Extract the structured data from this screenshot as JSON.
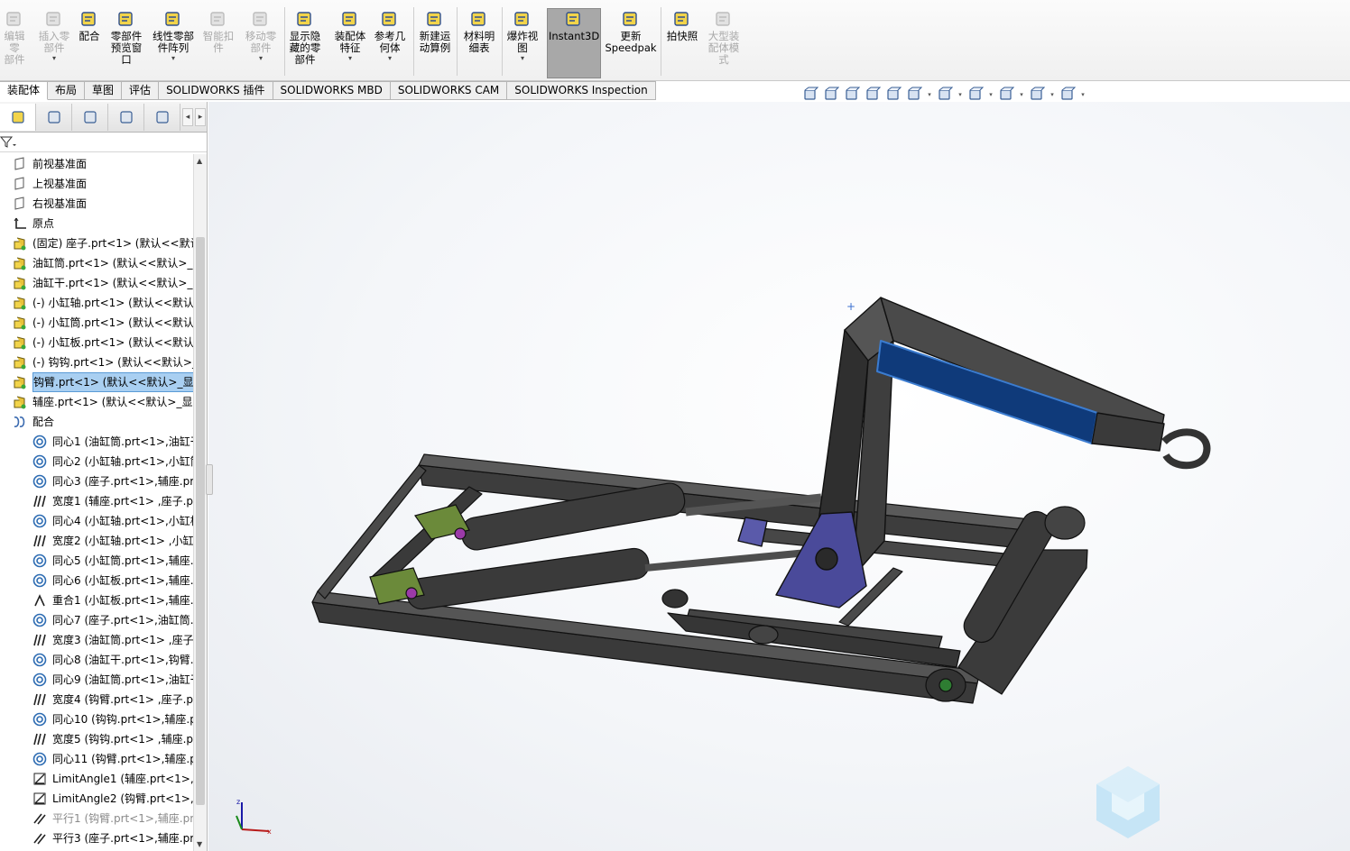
{
  "ribbon": {
    "buttons": [
      {
        "label": "编辑零\n部件",
        "icon": "edit-component-icon",
        "enabled": false
      },
      {
        "label": "插入零\n部件",
        "icon": "insert-component-icon",
        "enabled": false,
        "dropdown": true
      },
      {
        "label": "配合",
        "icon": "mate-icon",
        "enabled": true
      },
      {
        "label": "零部件\n预览窗\n口",
        "icon": "component-preview-icon",
        "enabled": true
      },
      {
        "label": "线性零部\n件阵列",
        "icon": "linear-pattern-icon",
        "enabled": true,
        "dropdown": true
      },
      {
        "label": "智能扣\n件",
        "icon": "smart-fasteners-icon",
        "enabled": false
      },
      {
        "label": "移动零\n部件",
        "icon": "move-component-icon",
        "enabled": false,
        "dropdown": true
      },
      {
        "label": "显示隐\n藏的零\n部件",
        "icon": "show-hidden-icon",
        "enabled": true
      },
      {
        "label": "装配体\n特征",
        "icon": "assembly-feature-icon",
        "enabled": true,
        "dropdown": true
      },
      {
        "label": "参考几\n何体",
        "icon": "reference-geometry-icon",
        "enabled": true,
        "dropdown": true
      },
      {
        "label": "新建运\n动算例",
        "icon": "motion-study-icon",
        "enabled": true
      },
      {
        "label": "材料明\n细表",
        "icon": "bom-icon",
        "enabled": true
      },
      {
        "label": "爆炸视\n图",
        "icon": "exploded-view-icon",
        "enabled": true,
        "dropdown": true
      },
      {
        "label": "Instant3D",
        "icon": "instant3d-icon",
        "enabled": true,
        "active": true
      },
      {
        "label": "更新\nSpeedpak",
        "icon": "speedpak-icon",
        "enabled": true
      },
      {
        "label": "拍快照",
        "icon": "snapshot-icon",
        "enabled": true
      },
      {
        "label": "大型装\n配体模\n式",
        "icon": "large-assembly-icon",
        "enabled": false
      }
    ]
  },
  "tabs": [
    "装配体",
    "布局",
    "草图",
    "评估",
    "SOLIDWORKS 插件",
    "SOLIDWORKS MBD",
    "SOLIDWORKS CAM",
    "SOLIDWORKS Inspection"
  ],
  "active_tab": "装配体",
  "panel": {
    "tabs": [
      "featuremanager-icon",
      "propertymanager-icon",
      "configurationmanager-icon",
      "dimxpert-icon",
      "display-manager-icon"
    ],
    "tree": [
      {
        "label": "前视基准面",
        "icon": "plane-icon",
        "indent": 0
      },
      {
        "label": "上视基准面",
        "icon": "plane-icon",
        "indent": 0
      },
      {
        "label": "右视基准面",
        "icon": "plane-icon",
        "indent": 0
      },
      {
        "label": "原点",
        "icon": "origin-icon",
        "indent": 0
      },
      {
        "label": "(固定) 座子.prt<1> (默认<<默认",
        "icon": "part-icon",
        "indent": 0
      },
      {
        "label": "油缸筒.prt<1> (默认<<默认>_显",
        "icon": "part-icon",
        "indent": 0
      },
      {
        "label": "油缸干.prt<1> (默认<<默认>_显",
        "icon": "part-icon",
        "indent": 0
      },
      {
        "label": "(-) 小缸轴.prt<1> (默认<<默认",
        "icon": "part-icon",
        "indent": 0
      },
      {
        "label": "(-) 小缸筒.prt<1> (默认<<默认",
        "icon": "part-icon",
        "indent": 0
      },
      {
        "label": "(-) 小缸板.prt<1> (默认<<默认",
        "icon": "part-icon",
        "indent": 0
      },
      {
        "label": "(-) 钩钩.prt<1> (默认<<默认>_",
        "icon": "part-icon",
        "indent": 0
      },
      {
        "label": "钩臂.prt<1> (默认<<默认>_显示",
        "icon": "part-icon",
        "indent": 0,
        "selected": true
      },
      {
        "label": "辅座.prt<1> (默认<<默认>_显示",
        "icon": "part-icon",
        "indent": 0
      },
      {
        "label": "配合",
        "icon": "mates-folder-icon",
        "indent": 0
      },
      {
        "label": "同心1 (油缸筒.prt<1>,油缸干",
        "icon": "concentric-icon",
        "indent": 1
      },
      {
        "label": "同心2 (小缸轴.prt<1>,小缸筒",
        "icon": "concentric-icon",
        "indent": 1
      },
      {
        "label": "同心3 (座子.prt<1>,辅座.prt",
        "icon": "concentric-icon",
        "indent": 1
      },
      {
        "label": "宽度1 (辅座.prt<1> ,座子.p",
        "icon": "width-icon",
        "indent": 1
      },
      {
        "label": "同心4 (小缸轴.prt<1>,小缸板",
        "icon": "concentric-icon",
        "indent": 1
      },
      {
        "label": "宽度2 (小缸轴.prt<1> ,小缸",
        "icon": "width-icon",
        "indent": 1
      },
      {
        "label": "同心5 (小缸筒.prt<1>,辅座.",
        "icon": "concentric-icon",
        "indent": 1
      },
      {
        "label": "同心6 (小缸板.prt<1>,辅座.",
        "icon": "concentric-icon",
        "indent": 1
      },
      {
        "label": "重合1 (小缸板.prt<1>,辅座.",
        "icon": "coincident-icon",
        "indent": 1
      },
      {
        "label": "同心7 (座子.prt<1>,油缸筒.",
        "icon": "concentric-icon",
        "indent": 1
      },
      {
        "label": "宽度3 (油缸筒.prt<1> ,座子.",
        "icon": "width-icon",
        "indent": 1
      },
      {
        "label": "同心8 (油缸干.prt<1>,钩臂.",
        "icon": "concentric-icon",
        "indent": 1
      },
      {
        "label": "同心9 (油缸筒.prt<1>,油缸干",
        "icon": "concentric-icon",
        "indent": 1
      },
      {
        "label": "宽度4 (钩臂.prt<1> ,座子.p",
        "icon": "width-icon",
        "indent": 1
      },
      {
        "label": "同心10 (钩钩.prt<1>,辅座.p",
        "icon": "concentric-icon",
        "indent": 1
      },
      {
        "label": "宽度5 (钩钩.prt<1> ,辅座.p",
        "icon": "width-icon",
        "indent": 1
      },
      {
        "label": "同心11 (钩臂.prt<1>,辅座.p",
        "icon": "concentric-icon",
        "indent": 1
      },
      {
        "label": "LimitAngle1 (辅座.prt<1>,座",
        "icon": "limit-angle-icon",
        "indent": 1
      },
      {
        "label": "LimitAngle2 (钩臂.prt<1>,座",
        "icon": "limit-angle-icon",
        "indent": 1
      },
      {
        "label": "平行1 (钩臂.prt<1>,辅座.pr",
        "icon": "parallel-icon",
        "indent": 1,
        "dim": true
      },
      {
        "label": "平行3 (座子.prt<1>,辅座.pr",
        "icon": "parallel-icon",
        "indent": 1
      }
    ]
  },
  "hud": [
    "zoom-to-fit-icon",
    "zoom-to-area-icon",
    "previous-view-icon",
    "section-view-icon",
    "dynamic-annotation-icon",
    "view-orientation-icon",
    "display-style-icon",
    "hide-show-items-icon",
    "edit-appearance-icon",
    "apply-scene-icon",
    "view-settings-icon"
  ],
  "colors": {
    "accent_blue": "#0f3a7a",
    "selection": "#a9cff1",
    "ribbon_active": "#a8a8a8",
    "model_dark": "#3c3c3c"
  }
}
